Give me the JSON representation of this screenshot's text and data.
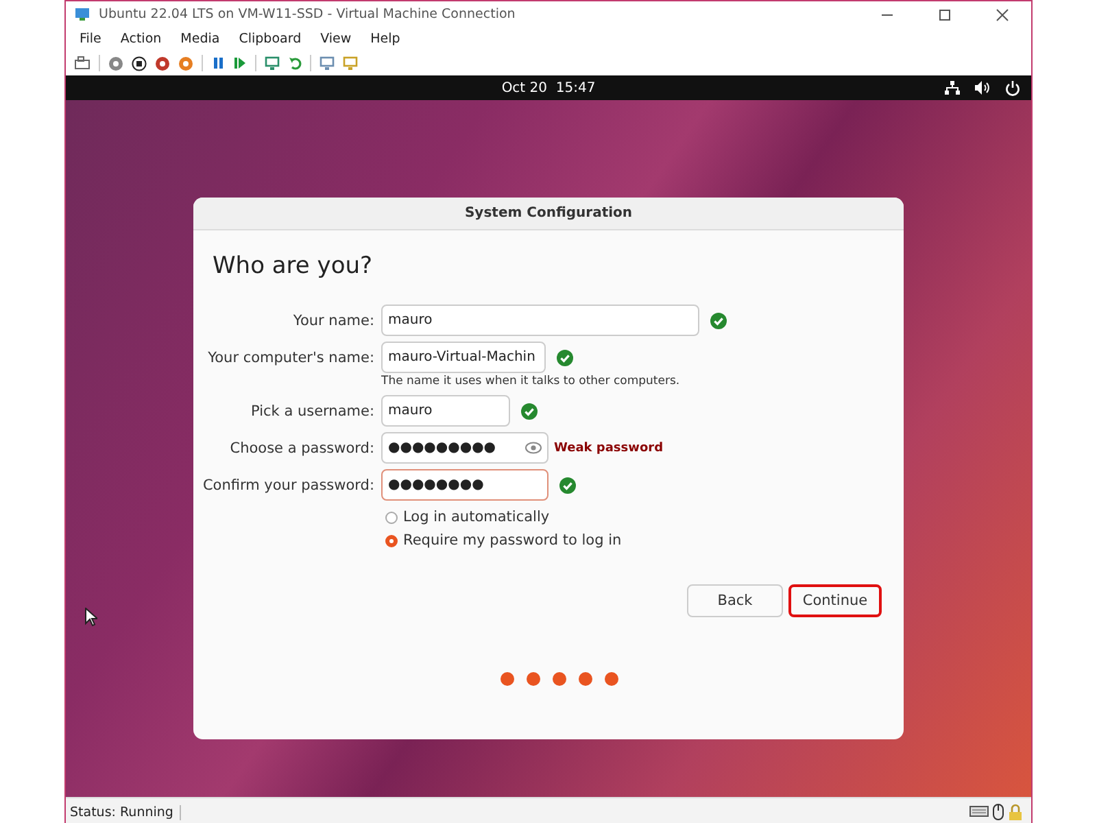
{
  "window": {
    "title": "Ubuntu 22.04 LTS on VM-W11-SSD - Virtual Machine Connection"
  },
  "menu": [
    "File",
    "Action",
    "Media",
    "Clipboard",
    "View",
    "Help"
  ],
  "top_bar": {
    "clock": "Oct 20  15:47"
  },
  "dialog": {
    "title": "System Configuration",
    "heading": "Who are you?",
    "fields": [
      {
        "label": "Your name:",
        "value": "mauro",
        "valid": true,
        "focused": false,
        "kind": "text"
      },
      {
        "label": "Your computer's name:",
        "value": "mauro-Virtual-Machin",
        "valid": true,
        "focused": false,
        "kind": "text",
        "hint": "The name it uses when it talks to other computers."
      },
      {
        "label": "Pick a username:",
        "value": "mauro",
        "valid": true,
        "focused": false,
        "kind": "text"
      },
      {
        "label": "Choose a password:",
        "value": "●●●●●●●●●",
        "valid": false,
        "focused": false,
        "kind": "password",
        "strength": "Weak password"
      },
      {
        "label": "Confirm your password:",
        "value": "●●●●●●●●",
        "valid": true,
        "focused": true,
        "kind": "text"
      }
    ],
    "login_options": [
      {
        "label": "Log in automatically",
        "selected": false
      },
      {
        "label": "Require my password to log in",
        "selected": true
      }
    ],
    "buttons": [
      {
        "label": "Back",
        "highlighted": false
      },
      {
        "label": "Continue",
        "highlighted": true
      }
    ]
  },
  "status_bar": {
    "status": "Status: Running"
  }
}
